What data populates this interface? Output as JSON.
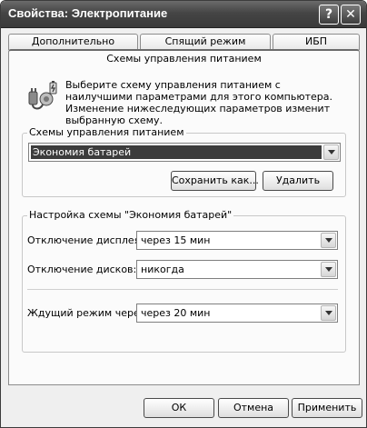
{
  "window": {
    "title": "Свойства: Электропитание",
    "help_glyph": "?",
    "close_glyph": "✕"
  },
  "tabs": [
    {
      "label": "Дополнительно",
      "selected": false
    },
    {
      "label": "Спящий режим",
      "selected": false
    },
    {
      "label": "ИБП",
      "selected": false
    },
    {
      "label": "Схемы управления питанием",
      "selected": true
    }
  ],
  "intro": {
    "icon": "power-settings-icon",
    "text": "Выберите схему управления питанием с наилучшими параметрами для этого компьютера. Изменение нижеследующих параметров изменит выбранную схему."
  },
  "schemes_group": {
    "label": "Схемы управления питанием",
    "selected_scheme": "Экономия батарей",
    "save_as_label": "Сохранить как...",
    "delete_label": "Удалить"
  },
  "settings_group": {
    "label": "Настройка схемы \"Экономия батарей\"",
    "display_off_label": "Отключение дисплея:",
    "display_off_value": "через 15 мин",
    "disks_off_label": "Отключение дисков:",
    "disks_off_value": "никогда",
    "standby_label": "Ждущий режим через:",
    "standby_value": "через 20 мин"
  },
  "footer": {
    "ok_label": "ОК",
    "cancel_label": "Отмена",
    "apply_label": "Применить"
  },
  "colors": {
    "titlebar": "#454545",
    "selected_item_bg": "#3c3c3c"
  }
}
